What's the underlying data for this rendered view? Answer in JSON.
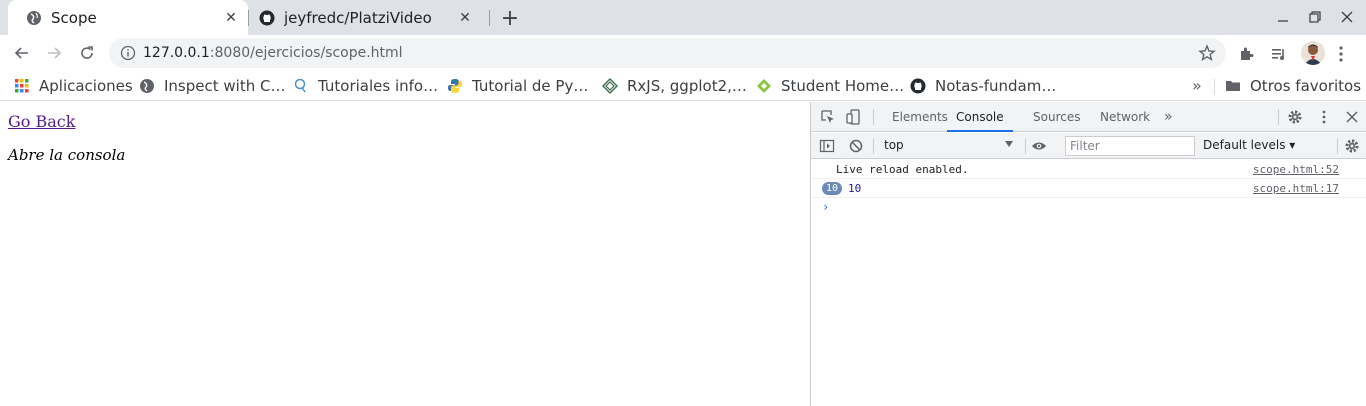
{
  "browser": {
    "tabs": [
      {
        "title": "Scope",
        "active": true,
        "icon": "globe-icon"
      },
      {
        "title": "jeyfredc/PlatziVideo",
        "active": false,
        "icon": "github-icon"
      }
    ],
    "url_host": "127.0.0.1",
    "url_rest": ":8080/ejercicios/scope.html",
    "bookmarks": [
      {
        "label": "Aplicaciones",
        "icon": "apps-grid-icon"
      },
      {
        "label": "Inspect with C…",
        "icon": "globe-icon"
      },
      {
        "label": "Tutoriales info…",
        "icon": "pin-icon"
      },
      {
        "label": "Tutorial de Py…",
        "icon": "python-icon"
      },
      {
        "label": "RxJS, ggplot2,…",
        "icon": "diamond-icon"
      },
      {
        "label": "Student Home…",
        "icon": "leaf-icon"
      },
      {
        "label": "Notas-fundam…",
        "icon": "github-icon"
      }
    ],
    "more_bookmarks": "»",
    "other_bookmarks": "Otros favoritos"
  },
  "page": {
    "link": "Go Back",
    "text": "Abre la consola"
  },
  "devtools": {
    "tabs": [
      "Elements",
      "Console",
      "Sources",
      "Network"
    ],
    "active_tab": "Console",
    "more_tabs": "»",
    "context": "top",
    "filter_placeholder": "Filter",
    "levels": "Default levels ▾",
    "logs": [
      {
        "message": "Live reload enabled.",
        "source": "scope.html:52"
      },
      {
        "count": "10",
        "message": "10",
        "source": "scope.html:17"
      }
    ],
    "prompt": "›"
  },
  "colors": {
    "accent": "#1a73e8",
    "tabstrip": "#dee1e6",
    "link_visited": "#551a8b"
  }
}
